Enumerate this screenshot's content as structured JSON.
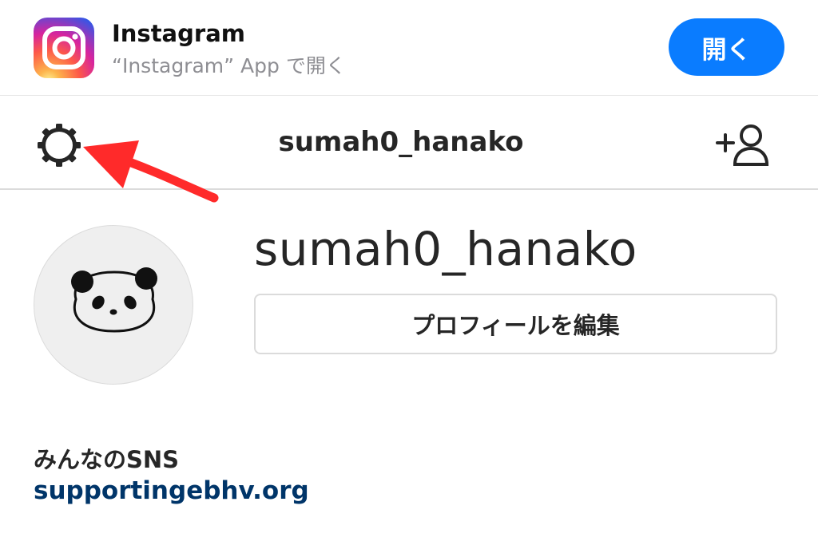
{
  "app_banner": {
    "app_name": "Instagram",
    "subtitle": "“Instagram” App で開く",
    "open_label": "開く",
    "icon": "instagram-icon"
  },
  "header": {
    "settings_icon": "gear-icon",
    "username": "sumah0_hanako",
    "add_person_icon": "add-person-icon"
  },
  "profile": {
    "avatar": "panda-avatar",
    "username": "sumah0_hanako",
    "edit_profile_label": "プロフィールを編集",
    "bio_name": "みんなのSNS",
    "website": "supportingebhv.org"
  },
  "colors": {
    "open_button": "#0a7cff",
    "link": "#003569",
    "annotation_arrow": "#ff0000"
  }
}
